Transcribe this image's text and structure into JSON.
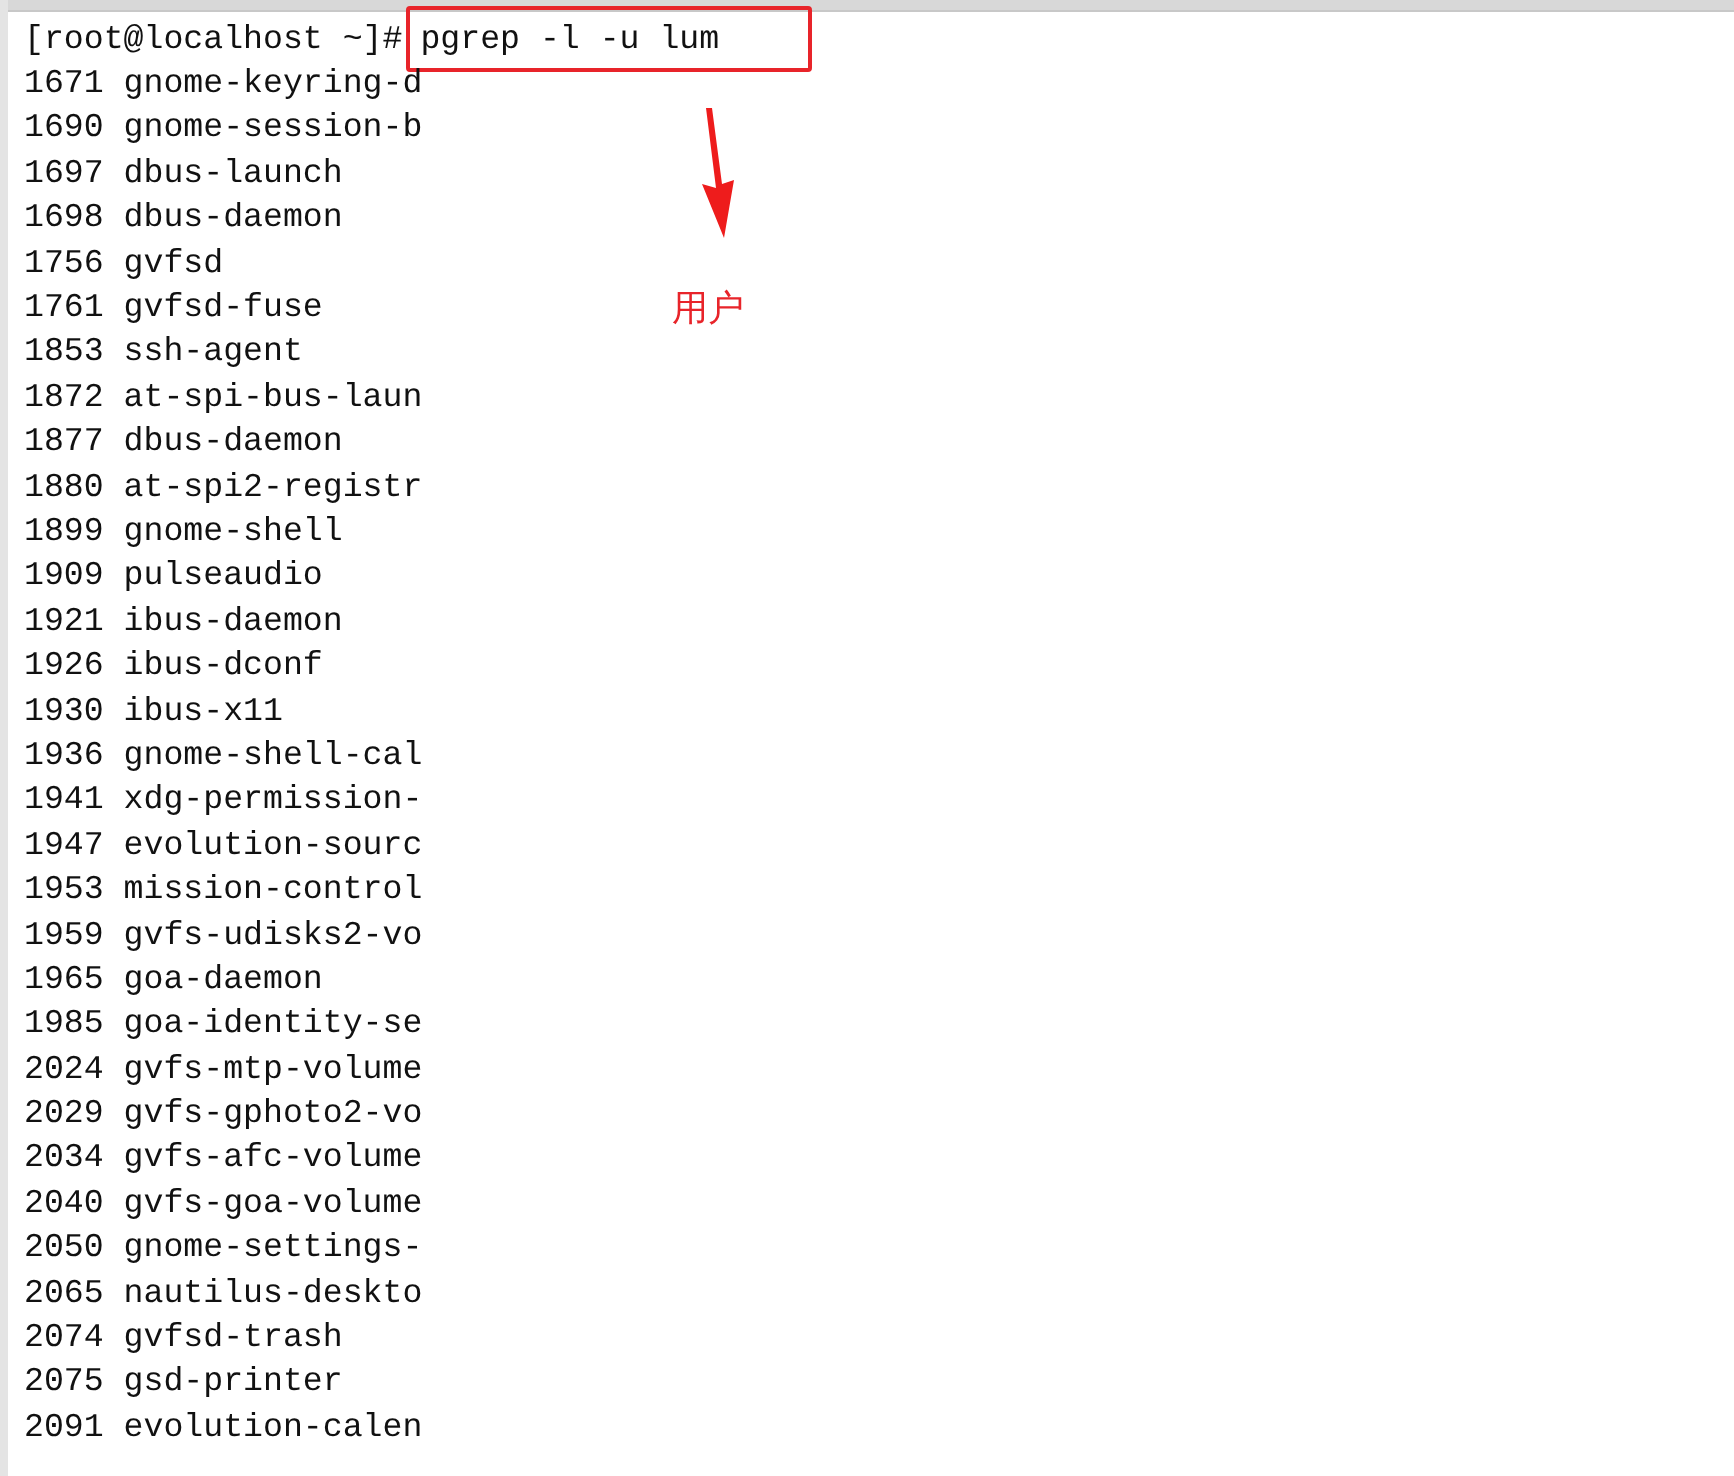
{
  "prompt": "[root@localhost ~]#",
  "command": "pgrep -l -u lum",
  "processes": [
    {
      "pid": "1671",
      "name": "gnome-keyring-d"
    },
    {
      "pid": "1690",
      "name": "gnome-session-b"
    },
    {
      "pid": "1697",
      "name": "dbus-launch"
    },
    {
      "pid": "1698",
      "name": "dbus-daemon"
    },
    {
      "pid": "1756",
      "name": "gvfsd"
    },
    {
      "pid": "1761",
      "name": "gvfsd-fuse"
    },
    {
      "pid": "1853",
      "name": "ssh-agent"
    },
    {
      "pid": "1872",
      "name": "at-spi-bus-laun"
    },
    {
      "pid": "1877",
      "name": "dbus-daemon"
    },
    {
      "pid": "1880",
      "name": "at-spi2-registr"
    },
    {
      "pid": "1899",
      "name": "gnome-shell"
    },
    {
      "pid": "1909",
      "name": "pulseaudio"
    },
    {
      "pid": "1921",
      "name": "ibus-daemon"
    },
    {
      "pid": "1926",
      "name": "ibus-dconf"
    },
    {
      "pid": "1930",
      "name": "ibus-x11"
    },
    {
      "pid": "1936",
      "name": "gnome-shell-cal"
    },
    {
      "pid": "1941",
      "name": "xdg-permission-"
    },
    {
      "pid": "1947",
      "name": "evolution-sourc"
    },
    {
      "pid": "1953",
      "name": "mission-control"
    },
    {
      "pid": "1959",
      "name": "gvfs-udisks2-vo"
    },
    {
      "pid": "1965",
      "name": "goa-daemon"
    },
    {
      "pid": "1985",
      "name": "goa-identity-se"
    },
    {
      "pid": "2024",
      "name": "gvfs-mtp-volume"
    },
    {
      "pid": "2029",
      "name": "gvfs-gphoto2-vo"
    },
    {
      "pid": "2034",
      "name": "gvfs-afc-volume"
    },
    {
      "pid": "2040",
      "name": "gvfs-goa-volume"
    },
    {
      "pid": "2050",
      "name": "gnome-settings-"
    },
    {
      "pid": "2065",
      "name": "nautilus-deskto"
    },
    {
      "pid": "2074",
      "name": "gvfsd-trash"
    },
    {
      "pid": "2075",
      "name": "gsd-printer"
    },
    {
      "pid": "2091",
      "name": "evolution-calen"
    }
  ],
  "annotation": {
    "label": "用户"
  }
}
